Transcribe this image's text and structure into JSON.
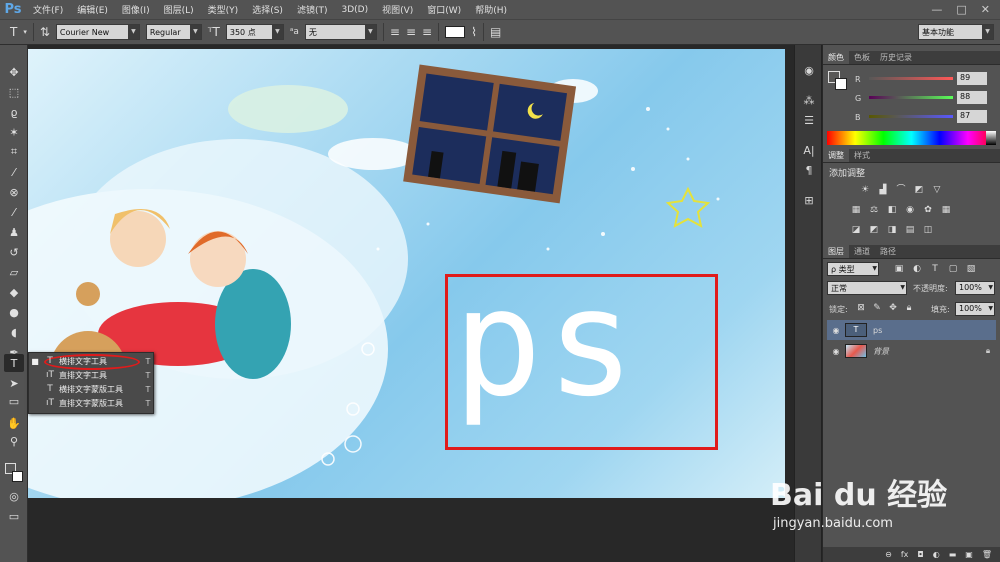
{
  "app": {
    "logo": "Ps"
  },
  "menu": [
    "文件(F)",
    "编辑(E)",
    "图像(I)",
    "图层(L)",
    "类型(Y)",
    "选择(S)",
    "滤镜(T)",
    "3D(D)",
    "视图(V)",
    "窗口(W)",
    "帮助(H)"
  ],
  "window_controls": [
    "—",
    "□",
    "✕"
  ],
  "options_bar": {
    "tool_glyph": "T",
    "font_family": "Courier New",
    "font_style": "Regular",
    "font_size": "350 点",
    "aa_label": "ᵃa",
    "antialias": "无",
    "workspace": "基本功能"
  },
  "canvas": {
    "text_layer": "ps"
  },
  "flyout": {
    "items": [
      {
        "icon": "T",
        "label": "横排文字工具",
        "key": "T",
        "selected": true
      },
      {
        "icon": "ıT",
        "label": "直排文字工具",
        "key": "T",
        "selected": false
      },
      {
        "icon": "T",
        "label": "横排文字蒙版工具",
        "key": "T",
        "selected": false
      },
      {
        "icon": "ıT",
        "label": "直排文字蒙版工具",
        "key": "T",
        "selected": false
      }
    ]
  },
  "color_panel": {
    "tabs": [
      "颜色",
      "色板",
      "历史记录"
    ],
    "channels": [
      {
        "name": "R",
        "value": "89"
      },
      {
        "name": "G",
        "value": "88"
      },
      {
        "name": "B",
        "value": "87"
      }
    ]
  },
  "adjust_panel": {
    "tabs": [
      "调整",
      "样式"
    ],
    "title": "添加调整"
  },
  "layers_panel": {
    "tabs": [
      "图层",
      "通道",
      "路径"
    ],
    "filter": "ρ 类型",
    "blend_mode": "正常",
    "opacity_label": "不透明度:",
    "opacity_value": "100%",
    "lock_label": "锁定:",
    "fill_label": "填充:",
    "fill_value": "100%",
    "layers": [
      {
        "name": "ps",
        "thumb": "T",
        "selected": true
      },
      {
        "name": "背景",
        "thumb": "",
        "selected": false
      }
    ]
  },
  "watermark": {
    "brand": "Bai du 经验",
    "url": "jingyan.baidu.com"
  },
  "colors": {
    "accent_red": "#e01b1b",
    "panel_bg": "#535353",
    "dark_bg": "#282828",
    "layer_selected": "#5a6e8c"
  }
}
